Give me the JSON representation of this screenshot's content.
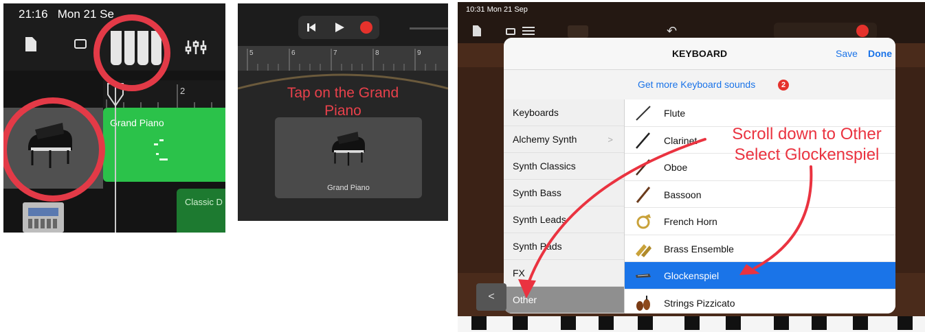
{
  "panel1": {
    "status_time": "21:16",
    "status_date": "Mon 21 Se",
    "ruler_mark": "2",
    "region_grand_piano": "Grand Piano",
    "region_classic": "Classic D",
    "highlight_color": "#e33a47"
  },
  "panel2": {
    "ruler_marks": [
      "5",
      "6",
      "7",
      "8",
      "9"
    ],
    "instruction": "Tap on the Grand Piano",
    "card_label": "Grand Piano"
  },
  "panel3": {
    "status": "10:31  Mon 21 Sep",
    "modal_title": "KEYBOARD",
    "save_label": "Save",
    "done_label": "Done",
    "more_sounds": "Get more Keyboard sounds",
    "more_badge": "2",
    "back_glyph": "<",
    "categories": [
      "Keyboards",
      "Alchemy Synth",
      "Synth Classics",
      "Synth Bass",
      "Synth Leads",
      "Synth Pads",
      "FX",
      "Other"
    ],
    "selected_category": "Other",
    "instruments": [
      "Flute",
      "Clarinet",
      "Oboe",
      "Bassoon",
      "French Horn",
      "Brass Ensemble",
      "Glockenspiel",
      "Strings Pizzicato"
    ],
    "selected_instrument": "Glockenspiel",
    "annotation_line1": "Scroll down to Other",
    "annotation_line2": "Select Glockenspiel",
    "accent_color": "#1a74e8",
    "annotation_color": "#ea3340"
  }
}
